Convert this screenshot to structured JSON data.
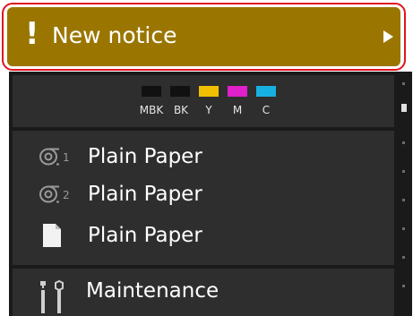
{
  "notice": {
    "icon_text": "!",
    "label": "New notice",
    "arrow": "chevron-right-icon"
  },
  "ink": {
    "items": [
      {
        "label": "MBK",
        "color": "#111111"
      },
      {
        "label": "BK",
        "color": "#111111"
      },
      {
        "label": "Y",
        "color": "#f0c000"
      },
      {
        "label": "M",
        "color": "#e020c8"
      },
      {
        "label": "C",
        "color": "#18b0e0"
      }
    ]
  },
  "paper": {
    "items": [
      {
        "label": "Plain Paper",
        "icon": "roll-1-icon",
        "index": "1"
      },
      {
        "label": "Plain Paper",
        "icon": "roll-2-icon",
        "index": "2"
      },
      {
        "label": "Plain Paper",
        "icon": "cut-sheet-icon"
      }
    ]
  },
  "maintenance": {
    "label": "Maintenance",
    "icon": "tools-icon"
  },
  "colors": {
    "notice_bg": "#9a7600",
    "highlight_outline": "#e0141e",
    "panel_bg": "#1a1a1a",
    "card_bg": "#2e2e2e"
  }
}
